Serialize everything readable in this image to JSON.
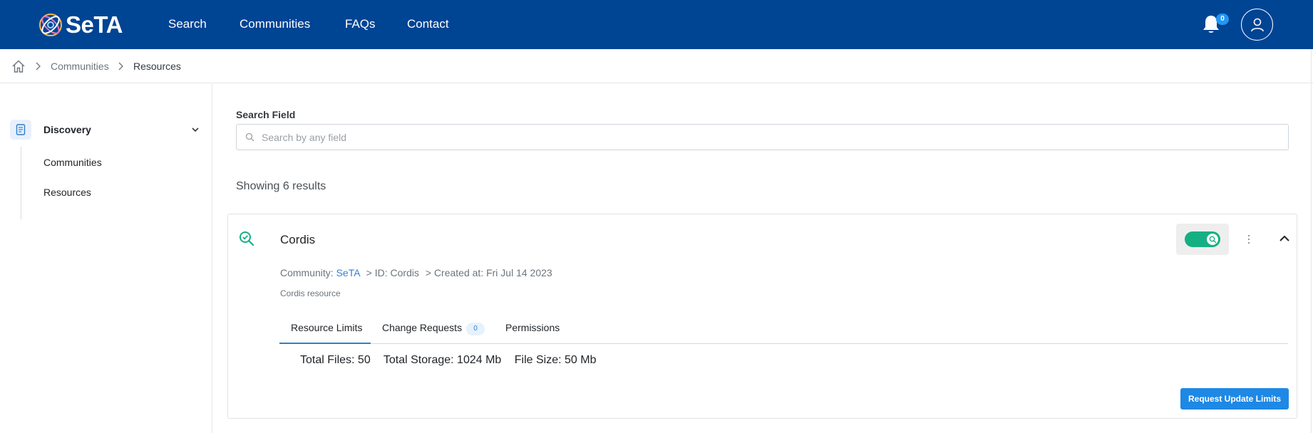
{
  "brand": {
    "name": "SeTA"
  },
  "nav": {
    "items": [
      {
        "label": "Search"
      },
      {
        "label": "Communities"
      },
      {
        "label": "FAQs"
      },
      {
        "label": "Contact"
      }
    ],
    "notifications_count": "0",
    "icons": {
      "notifications": "bell-icon",
      "account": "user-icon"
    }
  },
  "breadcrumb": {
    "items": [
      {
        "label": "Communities"
      },
      {
        "label": "Resources"
      }
    ]
  },
  "sidebar": {
    "section": {
      "label": "Discovery"
    },
    "items": [
      {
        "label": "Communities"
      },
      {
        "label": "Resources"
      }
    ]
  },
  "search": {
    "label": "Search Field",
    "placeholder": "Search by any field",
    "value": ""
  },
  "results": {
    "summary": "Showing 6 results"
  },
  "resource": {
    "title": "Cordis",
    "community_prefix": "Community:",
    "community": "SeTA",
    "id_text": "> ID: Cordis",
    "created_text": "> Created at: Fri Jul 14 2023",
    "description": "Cordis resource",
    "searchable_enabled": true,
    "tabs": [
      {
        "label": "Resource Limits",
        "active": true
      },
      {
        "label": "Change Requests",
        "badge": "0"
      },
      {
        "label": "Permissions"
      }
    ],
    "limits": {
      "total_files": "Total Files: 50",
      "total_storage": "Total Storage: 1024 Mb",
      "file_size": "File Size: 50 Mb"
    },
    "request_button": "Request Update Limits"
  },
  "colors": {
    "header_bg": "#004494",
    "accent": "#1e88e5",
    "toggle_on": "#14b084",
    "link": "#3880d0"
  }
}
